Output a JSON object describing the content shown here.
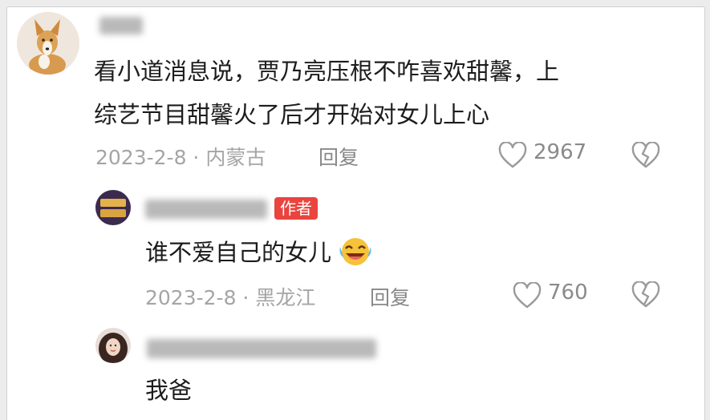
{
  "comment1": {
    "text_line1": "看小道消息说，贾乃亮压根不咋喜欢甜馨，上",
    "text_line2": "综艺节目甜馨火了后才开始对女儿上心",
    "meta": "2023-2-8 · 内蒙古",
    "reply": "回复",
    "likes": "2967"
  },
  "reply1": {
    "badge": "作者",
    "text": "谁不爱自己的女儿",
    "meta": "2023-2-8 · 黑龙江",
    "reply": "回复",
    "likes": "760"
  },
  "reply2": {
    "text": "我爸"
  },
  "colors": {
    "author_badge": "#e9443f",
    "icon_stroke": "#9a9a9a"
  }
}
